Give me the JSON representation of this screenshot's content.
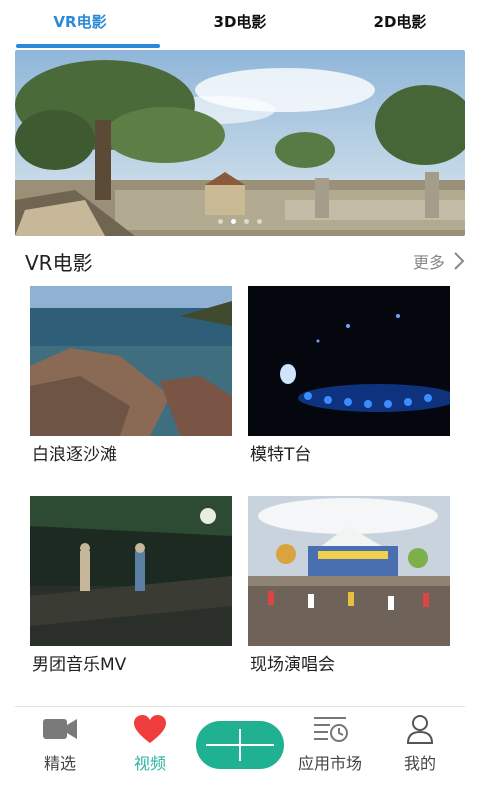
{
  "tabs": [
    {
      "label": "VR电影",
      "active": true
    },
    {
      "label": "3D电影",
      "active": false
    },
    {
      "label": "2D电影",
      "active": false
    }
  ],
  "banner": {
    "dot_count": 4,
    "active_dot": 2
  },
  "section": {
    "title": "VR电影",
    "more_label": "更多"
  },
  "cards": [
    {
      "title": "白浪逐沙滩"
    },
    {
      "title": "模特T台"
    },
    {
      "title": "男团音乐MV"
    },
    {
      "title": "现场演唱会"
    }
  ],
  "bottom_nav": {
    "items": [
      {
        "label": "精选",
        "icon": "video-camera-icon"
      },
      {
        "label": "视频",
        "icon": "heart-icon",
        "active": true
      },
      {
        "label": "应用市场",
        "icon": "app-list-clock-icon"
      },
      {
        "label": "我的",
        "icon": "person-icon"
      }
    ],
    "center_button_icon": "plus-icon"
  },
  "colors": {
    "accent": "#2b8ad8",
    "nav_active": "#2bb3a3",
    "plus_button": "#20b193"
  }
}
